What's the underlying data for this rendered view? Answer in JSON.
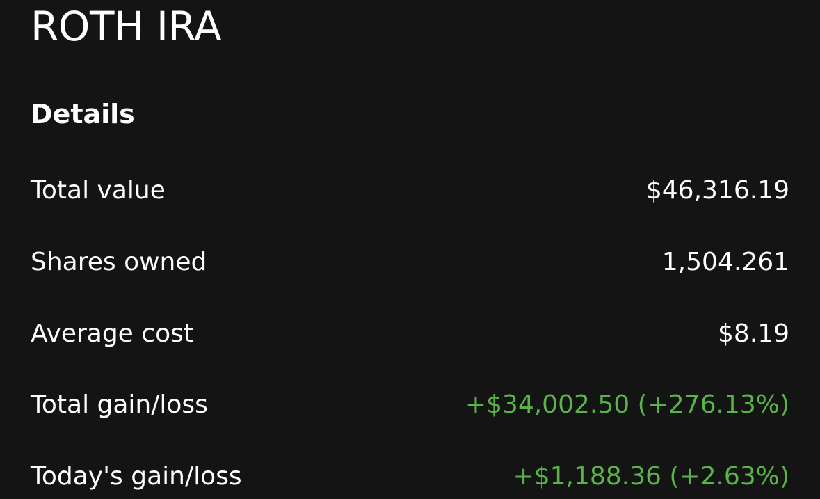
{
  "account": {
    "title": "ROTH IRA"
  },
  "details": {
    "heading": "Details",
    "rows": [
      {
        "label": "Total value",
        "value": "$46,316.19",
        "status": "neutral"
      },
      {
        "label": "Shares owned",
        "value": "1,504.261",
        "status": "neutral"
      },
      {
        "label": "Average cost",
        "value": "$8.19",
        "status": "neutral"
      },
      {
        "label": "Total gain/loss",
        "value": "+$34,002.50 (+276.13%)",
        "status": "positive"
      },
      {
        "label": "Today's gain/loss",
        "value": "+$1,188.36 (+2.63%)",
        "status": "positive"
      }
    ]
  },
  "colors": {
    "background": "#141414",
    "text": "#ffffff",
    "positive": "#59b548"
  }
}
